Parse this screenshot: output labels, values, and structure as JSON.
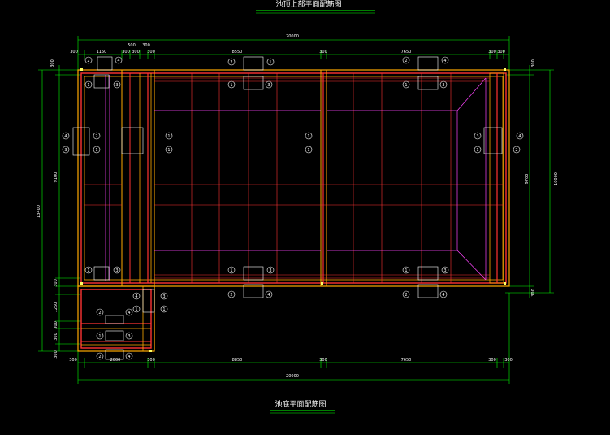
{
  "titles": {
    "top": "池顶上部平面配筋图",
    "bottom": "池底平面配筋图"
  },
  "dimensions": {
    "top_overall": "20000",
    "bottom_overall": "20000",
    "top_chain": [
      "300",
      "1150",
      "300",
      "300",
      "300",
      "8550",
      "300",
      "7650",
      "300",
      "300"
    ],
    "top_chain_mid": [
      "500",
      "300"
    ],
    "bottom_chain": [
      "300",
      "2000",
      "300",
      "8850",
      "300",
      "7650",
      "300",
      "300"
    ],
    "left_overall": "13400",
    "left_main": "9100",
    "left_chain": [
      "300",
      "300",
      "1250",
      "300",
      "300",
      "300"
    ],
    "right_overall": "10000",
    "right_main": "9700",
    "right_chain": [
      "300",
      "300"
    ]
  },
  "bar_marks": {
    "m1": "1",
    "m2": "2",
    "m3": "3",
    "m4": "4"
  },
  "colors": {
    "background": "#000000",
    "wall": "#ff3333",
    "wall_outline": "#ffaa00",
    "rebar_grid": "#ff3333",
    "slope": "#ff44ff",
    "dimension": "#00ff00",
    "text": "#ffffff",
    "marker": "#ffffff"
  }
}
